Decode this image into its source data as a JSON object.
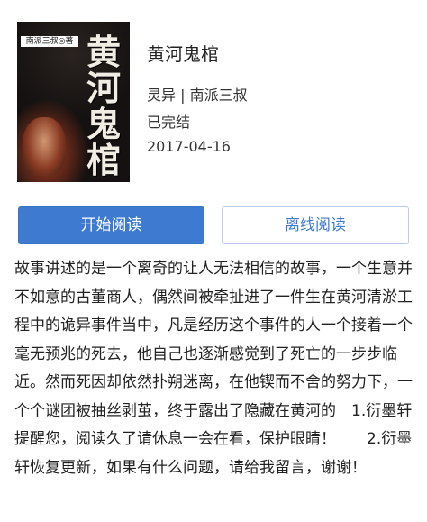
{
  "book": {
    "cover": {
      "title": "黄河鬼棺",
      "author_tag": "南派三叔◎著"
    },
    "title": "黄河鬼棺",
    "category_author": "灵异 | 南派三叔",
    "status": "已完结",
    "date": "2017-04-16"
  },
  "actions": {
    "start_label": "开始阅读",
    "offline_label": "离线阅读"
  },
  "description": "故事讲述的是一个离奇的让人无法相信的故事，一个生意并不如意的古董商人，偶然间被牵扯进了一件生在黄河清淤工程中的诡异事件当中，凡是经历这个事件的人一个接着一个毫无预兆的死去，他自己也逐渐感觉到了死亡的一步步临近。然而死因却依然扑朔迷离，在他锲而不舍的努力下，一个个谜团被抽丝剥茧，终于露出了隐藏在黄河的　1.衍墨轩提醒您，阅读久了请休息一会在看，保护眼睛！　　2.衍墨轩恢复更新，如果有什么问题，请给我留言，谢谢！",
  "colors": {
    "accent": "#3e7bd0",
    "text": "#222222"
  }
}
